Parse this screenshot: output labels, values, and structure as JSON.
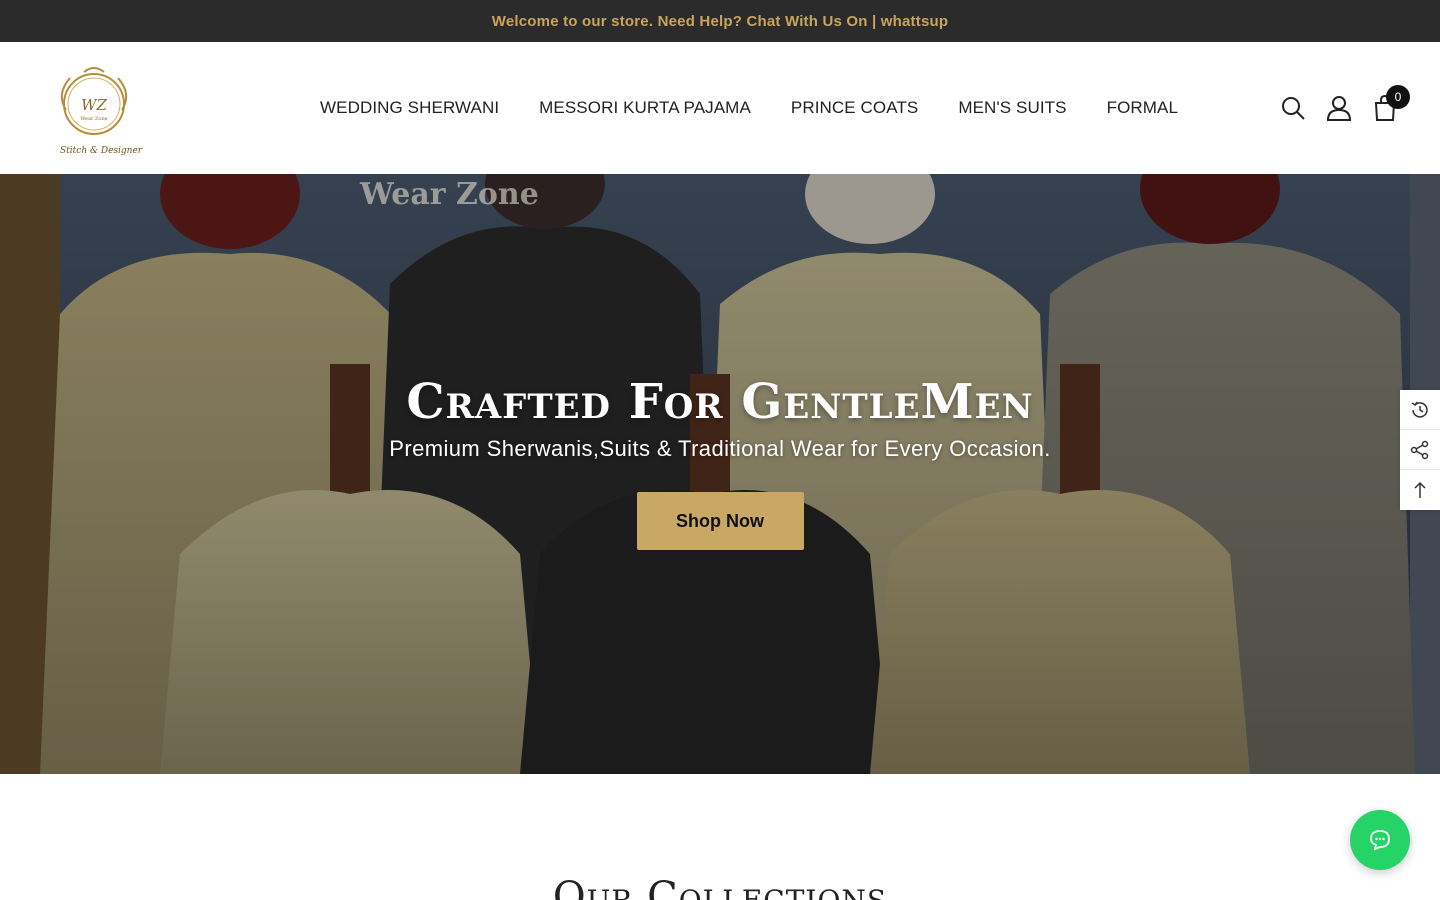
{
  "announcement": {
    "text": "Welcome to our store. Need Help? Chat With Us On | whattsup"
  },
  "logo": {
    "monogram": "WZ",
    "brand": "Wear Zone",
    "tagline": "Stitch & Designer"
  },
  "nav": {
    "items": [
      {
        "label": "WEDDING SHERWANI"
      },
      {
        "label": "MESSORI KURTA PAJAMA"
      },
      {
        "label": "PRINCE COATS"
      },
      {
        "label": "MEN'S SUITS"
      },
      {
        "label": "FORMAL"
      }
    ]
  },
  "header_icons": {
    "search": "search-icon",
    "account": "user-icon",
    "cart": "shopping-bag-icon",
    "cart_count": "0"
  },
  "hero": {
    "title": "Crafted For GentleMen",
    "subtitle": "Premium Sherwanis,Suits & Traditional Wear for Every Occasion.",
    "button_label": "Shop Now",
    "sign_text": "Wear Zone"
  },
  "side_tools": [
    "recently-viewed-icon",
    "share-icon",
    "back-to-top-icon"
  ],
  "chat": {
    "icon": "chat-icon",
    "color": "#25d366"
  },
  "collections": {
    "heading": "Our Collections"
  },
  "colors": {
    "accent_gold": "#c9a866",
    "announce_text": "#c9a45c",
    "announce_bg": "#2b2b2b"
  }
}
